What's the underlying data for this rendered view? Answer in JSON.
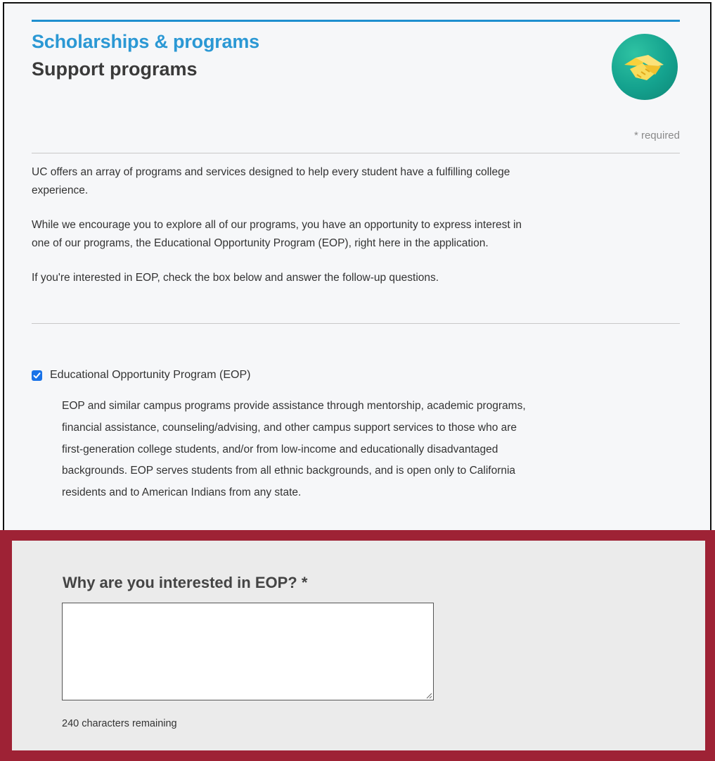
{
  "header": {
    "title": "Scholarships & programs",
    "subtitle": "Support programs",
    "badge_icon": "handshake-icon",
    "required_note": "* required"
  },
  "intro": {
    "paragraphs": [
      "UC offers an array of programs and services designed to help every student have a fulfilling college experience.",
      "While we encourage you to explore all of our programs, you have an opportunity to express interest in one of our programs, the Educational Opportunity Program (EOP), right here in the application.",
      "If you're interested in EOP, check the box below and answer the follow-up questions."
    ]
  },
  "eop": {
    "checkbox_label": "Educational Opportunity Program (EOP)",
    "checked": true,
    "description": "EOP and similar campus programs provide assistance through mentorship, academic programs, financial assistance, counseling/advising, and other campus support services to those who are first-generation college students, and/or from low-income and educationally disadvantaged backgrounds. EOP serves students from all ethnic backgrounds, and is open only to California residents and to American Indians from any state."
  },
  "question": {
    "label": "Why are you interested in EOP? *",
    "value": "",
    "counter": "240 characters remaining"
  },
  "colors": {
    "accent_blue": "#2b98d4",
    "highlight_border": "#9e2235",
    "checkbox": "#1a73e8"
  }
}
